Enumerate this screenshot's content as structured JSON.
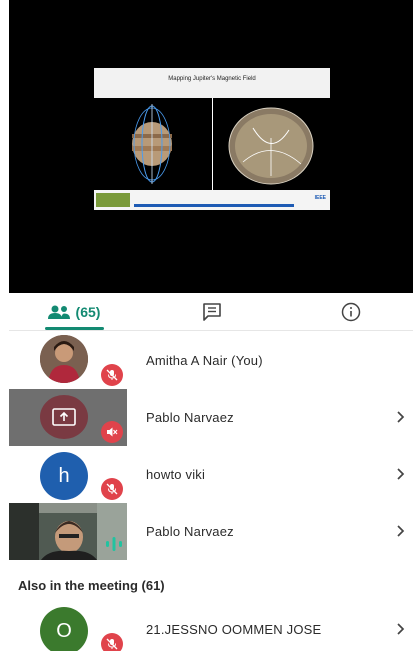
{
  "slide": {
    "title": "Mapping Jupiter's Magnetic Field",
    "footer_logo_right": "IEEE"
  },
  "tabs": {
    "people_count": "(65)",
    "people_icon": "people-icon",
    "chat_icon": "chat-icon",
    "info_icon": "info-icon"
  },
  "participants": [
    {
      "name": "Amitha A Nair (You)",
      "avatar": "photo",
      "muted": true
    },
    {
      "name": "Pablo Narvaez",
      "avatar": "screen-share-icon",
      "muted": true
    },
    {
      "name": "howto viki",
      "avatar_letter": "h",
      "avatar_color": "#1f5fae",
      "muted": true
    },
    {
      "name": "Pablo Narvaez",
      "avatar": "video",
      "speaking": true
    }
  ],
  "section": {
    "title": "Also in the meeting (61)"
  },
  "others": [
    {
      "name": "21.JESSNO OOMMEN JOSE",
      "avatar_letter": "O",
      "avatar_color": "#3b7a2d",
      "muted": true
    }
  ],
  "colors": {
    "accent": "#138a72",
    "mute": "#e0434b",
    "speaking": "#21c3a0"
  }
}
